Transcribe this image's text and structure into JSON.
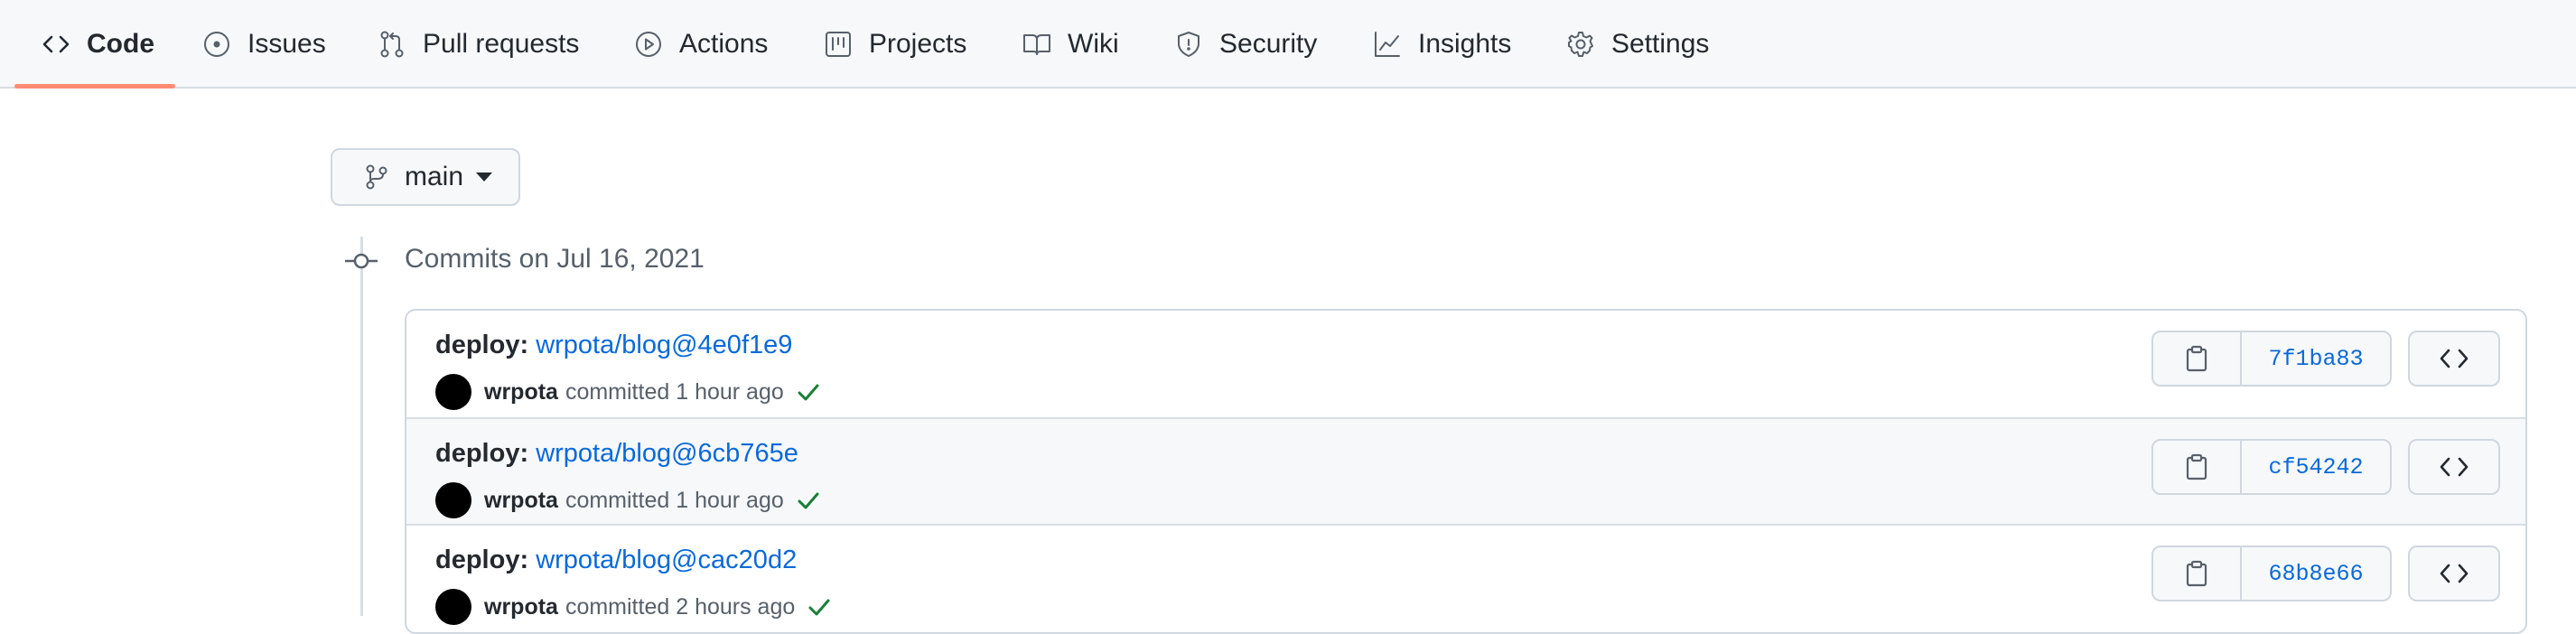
{
  "repo_nav": {
    "tabs": [
      {
        "label": "Code",
        "icon": "code-icon",
        "active": true
      },
      {
        "label": "Issues",
        "icon": "issue-icon"
      },
      {
        "label": "Pull requests",
        "icon": "pull-request-icon"
      },
      {
        "label": "Actions",
        "icon": "play-icon"
      },
      {
        "label": "Projects",
        "icon": "project-icon"
      },
      {
        "label": "Wiki",
        "icon": "book-icon"
      },
      {
        "label": "Security",
        "icon": "shield-icon"
      },
      {
        "label": "Insights",
        "icon": "graph-icon"
      },
      {
        "label": "Settings",
        "icon": "gear-icon"
      }
    ]
  },
  "branch_selector": {
    "label": "main",
    "icon": "git-branch-icon"
  },
  "commit_group": {
    "title": "Commits on Jul 16, 2021",
    "commits": [
      {
        "prefix": "deploy:",
        "ref": "wrpota/blog@4e0f1e9",
        "author": "wrpota",
        "action": "committed",
        "time": "1 hour ago",
        "status": "success",
        "sha": "7f1ba83"
      },
      {
        "prefix": "deploy:",
        "ref": "wrpota/blog@6cb765e",
        "author": "wrpota",
        "action": "committed",
        "time": "1 hour ago",
        "status": "success",
        "sha": "cf54242"
      },
      {
        "prefix": "deploy:",
        "ref": "wrpota/blog@cac20d2",
        "author": "wrpota",
        "action": "committed",
        "time": "2 hours ago",
        "status": "success",
        "sha": "68b8e66"
      }
    ]
  },
  "colors": {
    "accent": "#fd8c73",
    "link": "#0969da",
    "success": "#1a7f37"
  }
}
